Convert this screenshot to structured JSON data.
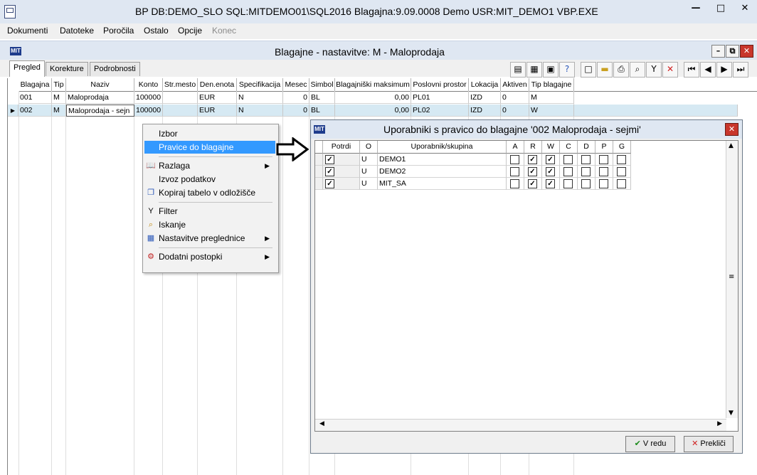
{
  "titlebar": {
    "title": "BP   DB:DEMO_SLO   SQL:MITDEMO01\\SQL2016   Blagajna:9.09.0008   Demo   USR:MIT_DEMO1   VBP.EXE",
    "minimize": "—",
    "maximize": "□",
    "close": "✕"
  },
  "menu": [
    "Dokumenti",
    "Datoteke",
    "Poročila",
    "Ostalo",
    "Opcije",
    "Konec"
  ],
  "mdi": {
    "logo": "MIT",
    "title": "Blagajne - nastavitve:  M - Maloprodaja"
  },
  "tabs": [
    "Pregled",
    "Korekture",
    "Podrobnosti"
  ],
  "grid": {
    "columns": [
      "Blagajna",
      "Tip",
      "Naziv",
      "Konto",
      "Str.mesto",
      "Den.enota",
      "Specifikacija",
      "Mesec",
      "Simbol",
      "Blagajniški maksimum",
      "Poslovni prostor",
      "Lokacija",
      "Aktiven",
      "Tip blagajne"
    ],
    "rows": [
      [
        "001",
        "M",
        "Maloprodaja",
        "100000",
        "",
        "EUR",
        "N",
        "0",
        "BL",
        "0,00",
        "PL01",
        "IZD",
        "0",
        "M"
      ],
      [
        "002",
        "M",
        "Maloprodaja - sejn",
        "100000",
        "",
        "EUR",
        "N",
        "0",
        "BL",
        "0,00",
        "PL02",
        "IZD",
        "0",
        "W"
      ]
    ]
  },
  "context_menu": {
    "items": [
      "Izbor",
      "Pravice do blagajne",
      "Razlaga",
      "Izvoz podatkov",
      "Kopiraj tabelo v odložišče",
      "Filter",
      "Iskanje",
      "Nastavitve preglednice",
      "Dodatni postopki"
    ]
  },
  "dialog": {
    "logo": "MIT",
    "title": "Uporabniki s pravico do blagajne '002  Maloprodaja - sejmi'",
    "columns": [
      "Potrdi",
      "O",
      "Uporabnik/skupina",
      "A",
      "R",
      "W",
      "C",
      "D",
      "P",
      "G"
    ],
    "rows": [
      {
        "potrdi": true,
        "o": "U",
        "user": "DEMO1",
        "perms": [
          false,
          true,
          true,
          false,
          false,
          false,
          false
        ]
      },
      {
        "potrdi": true,
        "o": "U",
        "user": "DEMO2",
        "perms": [
          false,
          true,
          true,
          false,
          false,
          false,
          false
        ]
      },
      {
        "potrdi": true,
        "o": "U",
        "user": "MIT_SA",
        "perms": [
          false,
          true,
          true,
          false,
          false,
          false,
          false
        ]
      }
    ],
    "ok_label": "V redu",
    "cancel_label": "Prekliči"
  }
}
